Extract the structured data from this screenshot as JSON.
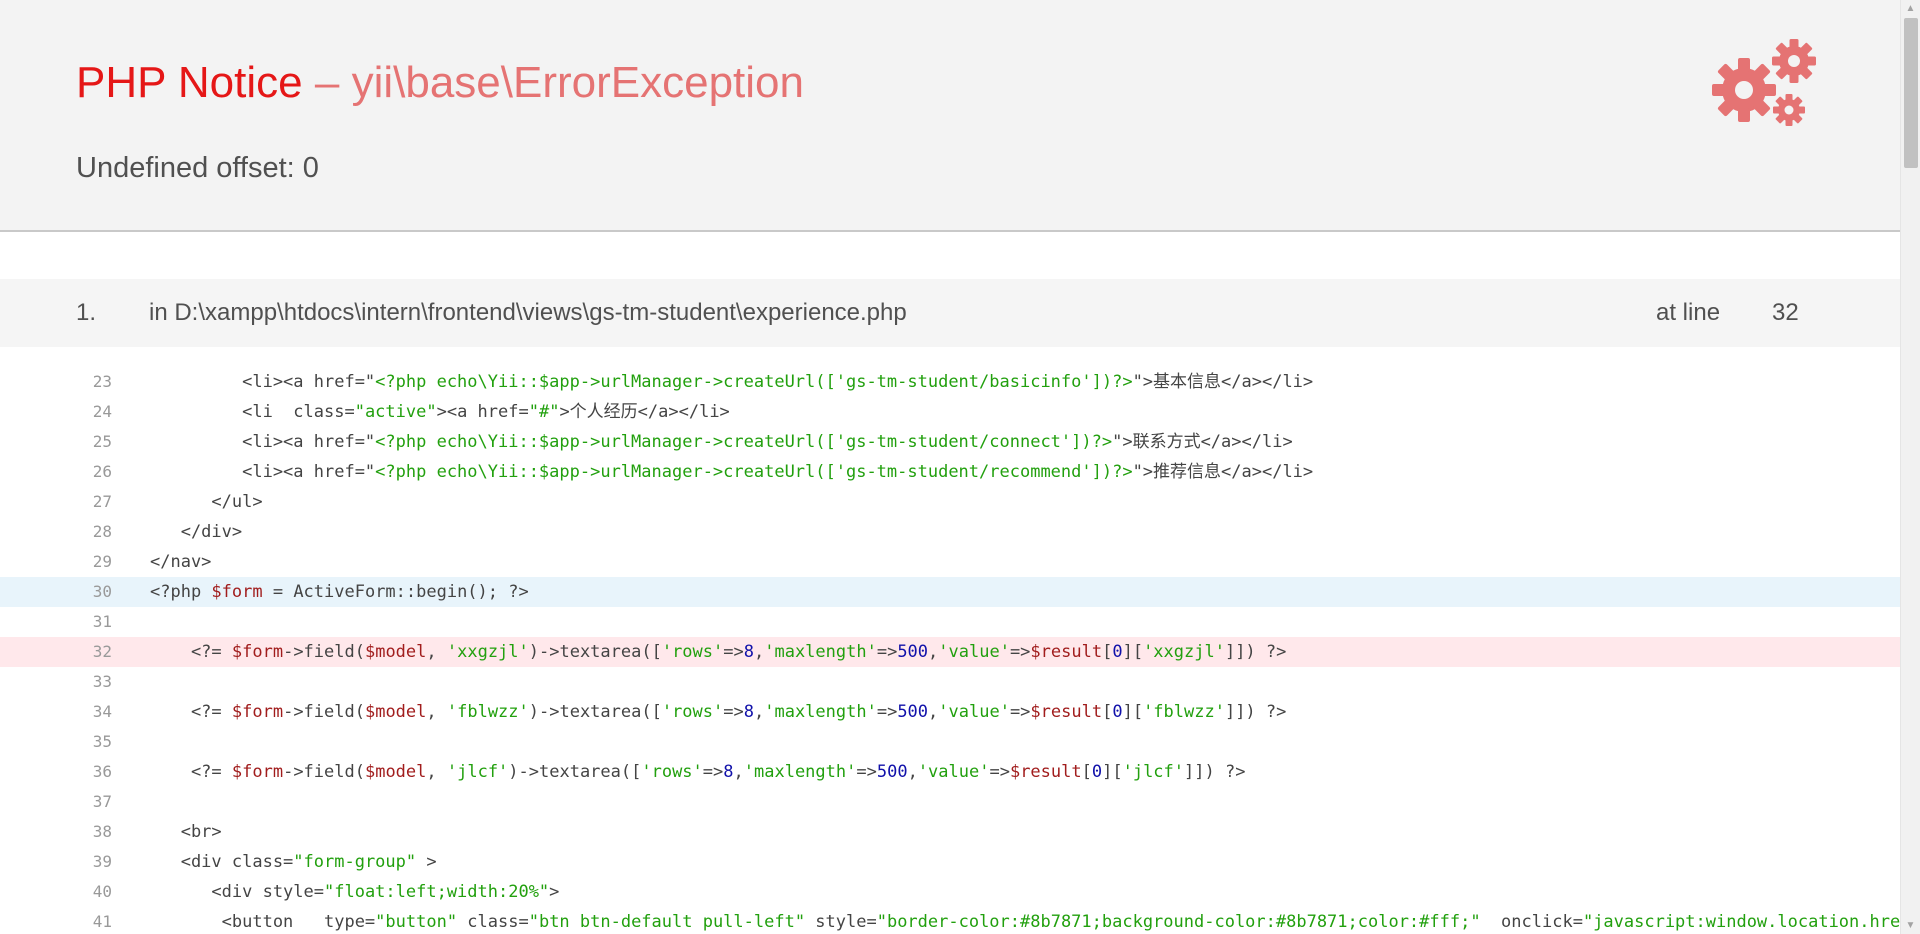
{
  "error": {
    "type": "PHP Notice",
    "separator": "–",
    "exception": "yii\\base\\ErrorException",
    "message": "Undefined offset: 0",
    "icon": "gears-icon",
    "accent_color": "#e51717"
  },
  "call_stack": [
    {
      "index": "1.",
      "file_text": "in D:\\xampp\\htdocs\\intern\\frontend\\views\\gs-tm-student\\experience.php",
      "at_line_label": "at line",
      "line": "32"
    }
  ],
  "code_lines": [
    {
      "num": "23",
      "tokens": [
        [
          "p",
          "         <li><a href=\""
        ],
        [
          "s",
          "<?php echo\\Yii::$app->urlManager->createUrl(['gs-tm-student/basicinfo'])?>"
        ],
        [
          "p",
          "\">基本信息</a></li>"
        ]
      ]
    },
    {
      "num": "24",
      "tokens": [
        [
          "p",
          "         <li  class="
        ],
        [
          "s",
          "\"active\""
        ],
        [
          "p",
          "><a href="
        ],
        [
          "s",
          "\"#\""
        ],
        [
          "p",
          ">个人经历</a></li>"
        ]
      ]
    },
    {
      "num": "25",
      "tokens": [
        [
          "p",
          "         <li><a href=\""
        ],
        [
          "s",
          "<?php echo\\Yii::$app->urlManager->createUrl(['gs-tm-student/connect'])?>"
        ],
        [
          "p",
          "\">联系方式</a></li>"
        ]
      ]
    },
    {
      "num": "26",
      "tokens": [
        [
          "p",
          "         <li><a href=\""
        ],
        [
          "s",
          "<?php echo\\Yii::$app->urlManager->createUrl(['gs-tm-student/recommend'])?>"
        ],
        [
          "p",
          "\">推荐信息</a></li>"
        ]
      ]
    },
    {
      "num": "27",
      "tokens": [
        [
          "p",
          "      </ul>"
        ]
      ]
    },
    {
      "num": "28",
      "tokens": [
        [
          "p",
          "   </div>"
        ]
      ]
    },
    {
      "num": "29",
      "tokens": [
        [
          "p",
          "</nav>"
        ]
      ]
    },
    {
      "num": "30",
      "highlight": "current",
      "tokens": [
        [
          "p",
          "<?php "
        ],
        [
          "v",
          "$form"
        ],
        [
          "p",
          " = ActiveForm::begin(); ?>"
        ]
      ]
    },
    {
      "num": "31",
      "tokens": []
    },
    {
      "num": "32",
      "highlight": "error",
      "tokens": [
        [
          "p",
          "    <?= "
        ],
        [
          "v",
          "$form"
        ],
        [
          "p",
          "->field("
        ],
        [
          "v",
          "$model"
        ],
        [
          "p",
          ", "
        ],
        [
          "s",
          "'xxgzjl'"
        ],
        [
          "p",
          ")->textarea(["
        ],
        [
          "s",
          "'rows'"
        ],
        [
          "p",
          "=>"
        ],
        [
          "n",
          "8"
        ],
        [
          "p",
          ","
        ],
        [
          "s",
          "'maxlength'"
        ],
        [
          "p",
          "=>"
        ],
        [
          "n",
          "500"
        ],
        [
          "p",
          ","
        ],
        [
          "s",
          "'value'"
        ],
        [
          "p",
          "=>"
        ],
        [
          "v",
          "$result"
        ],
        [
          "p",
          "["
        ],
        [
          "n",
          "0"
        ],
        [
          "p",
          "]["
        ],
        [
          "s",
          "'xxgzjl'"
        ],
        [
          "p",
          "]]) ?>"
        ]
      ]
    },
    {
      "num": "33",
      "tokens": []
    },
    {
      "num": "34",
      "tokens": [
        [
          "p",
          "    <?= "
        ],
        [
          "v",
          "$form"
        ],
        [
          "p",
          "->field("
        ],
        [
          "v",
          "$model"
        ],
        [
          "p",
          ", "
        ],
        [
          "s",
          "'fblwzz'"
        ],
        [
          "p",
          ")->textarea(["
        ],
        [
          "s",
          "'rows'"
        ],
        [
          "p",
          "=>"
        ],
        [
          "n",
          "8"
        ],
        [
          "p",
          ","
        ],
        [
          "s",
          "'maxlength'"
        ],
        [
          "p",
          "=>"
        ],
        [
          "n",
          "500"
        ],
        [
          "p",
          ","
        ],
        [
          "s",
          "'value'"
        ],
        [
          "p",
          "=>"
        ],
        [
          "v",
          "$result"
        ],
        [
          "p",
          "["
        ],
        [
          "n",
          "0"
        ],
        [
          "p",
          "]["
        ],
        [
          "s",
          "'fblwzz'"
        ],
        [
          "p",
          "]]) ?>"
        ]
      ]
    },
    {
      "num": "35",
      "tokens": []
    },
    {
      "num": "36",
      "tokens": [
        [
          "p",
          "    <?= "
        ],
        [
          "v",
          "$form"
        ],
        [
          "p",
          "->field("
        ],
        [
          "v",
          "$model"
        ],
        [
          "p",
          ", "
        ],
        [
          "s",
          "'jlcf'"
        ],
        [
          "p",
          ")->textarea(["
        ],
        [
          "s",
          "'rows'"
        ],
        [
          "p",
          "=>"
        ],
        [
          "n",
          "8"
        ],
        [
          "p",
          ","
        ],
        [
          "s",
          "'maxlength'"
        ],
        [
          "p",
          "=>"
        ],
        [
          "n",
          "500"
        ],
        [
          "p",
          ","
        ],
        [
          "s",
          "'value'"
        ],
        [
          "p",
          "=>"
        ],
        [
          "v",
          "$result"
        ],
        [
          "p",
          "["
        ],
        [
          "n",
          "0"
        ],
        [
          "p",
          "]["
        ],
        [
          "s",
          "'jlcf'"
        ],
        [
          "p",
          "]]) ?>"
        ]
      ]
    },
    {
      "num": "37",
      "tokens": []
    },
    {
      "num": "38",
      "tokens": [
        [
          "p",
          "   <br>"
        ]
      ]
    },
    {
      "num": "39",
      "tokens": [
        [
          "p",
          "   <div class="
        ],
        [
          "s",
          "\"form-group\""
        ],
        [
          "p",
          " >"
        ]
      ]
    },
    {
      "num": "40",
      "tokens": [
        [
          "p",
          "      <div style="
        ],
        [
          "s",
          "\"float:left;width:20%\""
        ],
        [
          "p",
          ">"
        ]
      ]
    },
    {
      "num": "41",
      "tokens": [
        [
          "p",
          "       <button   type="
        ],
        [
          "s",
          "\"button\""
        ],
        [
          "p",
          " class="
        ],
        [
          "s",
          "\"btn btn-default pull-left\""
        ],
        [
          "p",
          " style="
        ],
        [
          "s",
          "\"border-color:#8b7871;background-color:#8b7871;color:#fff;\""
        ],
        [
          "p",
          "  onclick="
        ],
        [
          "s",
          "\"javascript:window.location.href='bas"
        ]
      ]
    }
  ]
}
